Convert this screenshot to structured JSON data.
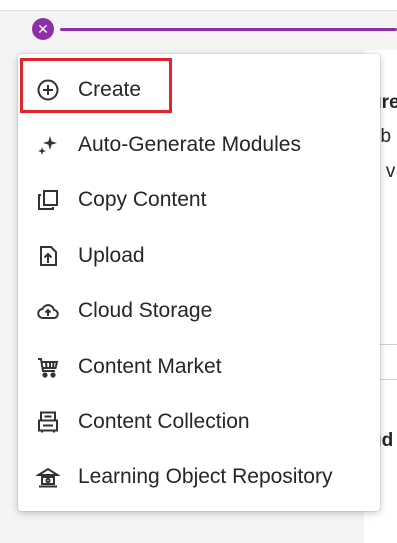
{
  "menu": {
    "items": [
      {
        "label": "Create",
        "icon": "plus-circle-icon"
      },
      {
        "label": "Auto-Generate Modules",
        "icon": "sparkle-icon"
      },
      {
        "label": "Copy Content",
        "icon": "copy-icon"
      },
      {
        "label": "Upload",
        "icon": "upload-icon"
      },
      {
        "label": "Cloud Storage",
        "icon": "cloud-upload-icon"
      },
      {
        "label": "Content Market",
        "icon": "cart-icon"
      },
      {
        "label": "Content Collection",
        "icon": "collection-icon"
      },
      {
        "label": "Learning Object Repository",
        "icon": "repository-icon"
      }
    ]
  },
  "background": {
    "text_1": "ure",
    "text_2": "rib",
    "text_3": "o v",
    "text_4": "ud"
  },
  "colors": {
    "accent": "#8f2fa8",
    "focus": "#e0262c"
  }
}
